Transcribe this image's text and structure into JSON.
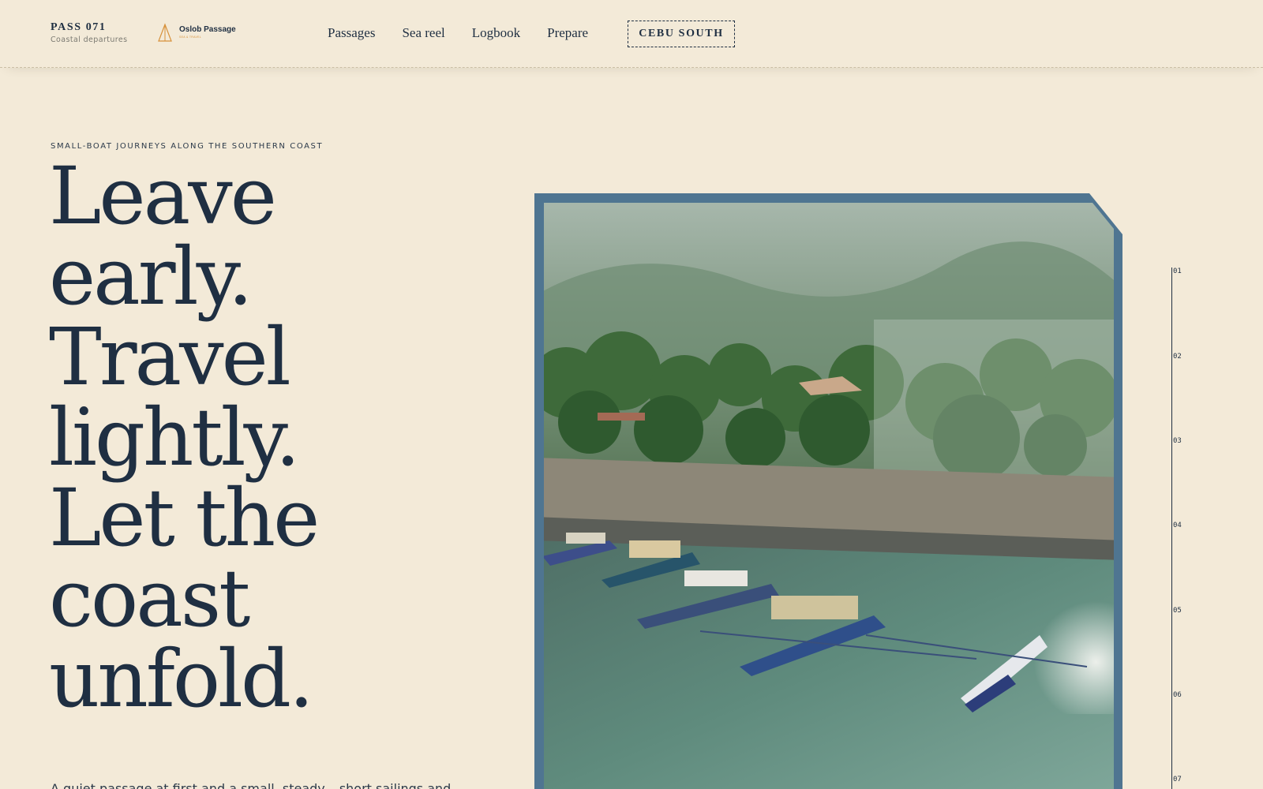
{
  "brand": {
    "title": "PASS 071",
    "subtitle": "Coastal departures"
  },
  "partner": {
    "name": "Oslob Passage",
    "tagline": "SEA & TRAVEL"
  },
  "nav": {
    "items": [
      "Passages",
      "Sea reel",
      "Logbook",
      "Prepare"
    ],
    "cta": "CEBU SOUTH"
  },
  "hero": {
    "eyebrow": "SMALL-BOAT JOURNEYS ALONG THE SOUTHERN COAST",
    "headline": [
      "Leave",
      "early.",
      "Travel",
      "lightly.",
      "Let the",
      "coast",
      "unfold."
    ],
    "lede": "A quiet passage at first and a small, steady...    short sailings and"
  },
  "rail": {
    "ticks": [
      "01",
      "02",
      "03",
      "04",
      "05",
      "06",
      "07"
    ]
  },
  "colors": {
    "ink": "#1f2f42",
    "paper": "#f3ead8",
    "frame": "#4f7591",
    "accent": "#d7913a"
  }
}
